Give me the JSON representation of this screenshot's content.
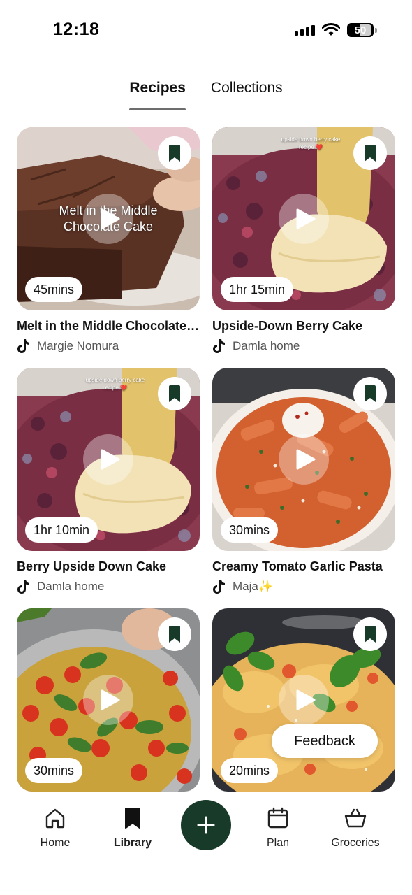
{
  "status_bar": {
    "time": "12:18",
    "battery": "50"
  },
  "tabs": [
    {
      "label": "Recipes",
      "active": true
    },
    {
      "label": "Collections",
      "active": false
    }
  ],
  "recipes": [
    {
      "title": "Melt in the Middle Chocolate Cake",
      "author": "Margie Nomura",
      "duration": "45mins",
      "overlay_text": "Melt in the Middle\nChocolate Cake",
      "overlay_caption": "",
      "image": "chocolate-cake"
    },
    {
      "title": "Upside-Down Berry Cake",
      "author": "Damla home",
      "duration": "1hr 15min",
      "overlay_text": "",
      "overlay_caption": "upside down berry cake\nrecipe ❤️",
      "image": "berry-cake"
    },
    {
      "title": "Berry Upside Down Cake",
      "author": "Damla home",
      "duration": "1hr 10min",
      "overlay_text": "",
      "overlay_caption": "upside down berry cake\nrecipe ❤️",
      "image": "berry-cake"
    },
    {
      "title": "Creamy Tomato Garlic Pasta",
      "author": "Maja✨",
      "duration": "30mins",
      "overlay_text": "",
      "overlay_caption": "",
      "image": "tomato-pasta"
    },
    {
      "title": "",
      "author": "",
      "duration": "30mins",
      "overlay_text": "",
      "overlay_caption": "",
      "image": "cherry-tomato-pan"
    },
    {
      "title": "",
      "author": "",
      "duration": "20mins",
      "overlay_text": "",
      "overlay_caption": "",
      "image": "ravioli-basil"
    }
  ],
  "feedback_label": "Feedback",
  "bottom_nav": {
    "items": [
      {
        "label": "Home",
        "icon": "home-icon",
        "active": false
      },
      {
        "label": "Library",
        "icon": "bookmark-icon",
        "active": true
      },
      {
        "label": "Plan",
        "icon": "calendar-icon",
        "active": false
      },
      {
        "label": "Groceries",
        "icon": "basket-icon",
        "active": false
      }
    ],
    "add_icon": "plus-icon"
  },
  "colors": {
    "accent": "#183a28",
    "bookmark": "#183a28"
  }
}
